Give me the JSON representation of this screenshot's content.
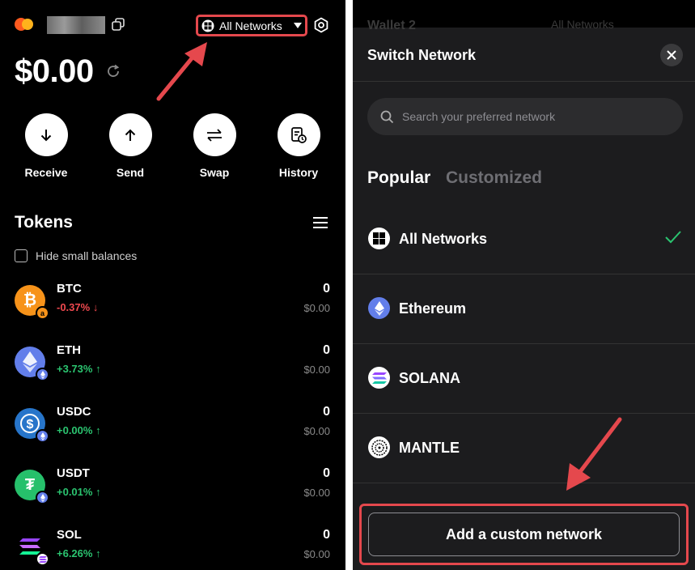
{
  "left": {
    "network_button_label": "All Networks",
    "balance": "$0.00",
    "actions": [
      {
        "label": "Receive",
        "icon": "arrow-down-icon"
      },
      {
        "label": "Send",
        "icon": "arrow-up-icon"
      },
      {
        "label": "Swap",
        "icon": "swap-icon"
      },
      {
        "label": "History",
        "icon": "history-icon"
      }
    ],
    "tokens_title": "Tokens",
    "hide_small_balances": "Hide small balances",
    "tokens": [
      {
        "symbol": "BTC",
        "change": "-0.37%",
        "direction": "down",
        "amount": "0",
        "usd": "$0.00",
        "color": "#f7931a"
      },
      {
        "symbol": "ETH",
        "change": "+3.73%",
        "direction": "up",
        "amount": "0",
        "usd": "$0.00",
        "color": "#627eea"
      },
      {
        "symbol": "USDC",
        "change": "+0.00%",
        "direction": "up",
        "amount": "0",
        "usd": "$0.00",
        "color": "#2775ca"
      },
      {
        "symbol": "USDT",
        "change": "+0.01%",
        "direction": "up",
        "amount": "0",
        "usd": "$0.00",
        "color": "#26c06b"
      },
      {
        "symbol": "SOL",
        "change": "+6.26%",
        "direction": "up",
        "amount": "0",
        "usd": "$0.00",
        "color": "#000000"
      }
    ]
  },
  "right": {
    "ghost_wallet": "Wallet 2",
    "ghost_network": "All Networks",
    "title": "Switch Network",
    "search_placeholder": "Search your preferred network",
    "tabs": [
      "Popular",
      "Customized"
    ],
    "networks": [
      {
        "label": "All Networks",
        "icon": "all-networks-icon",
        "selected": true
      },
      {
        "label": "Ethereum",
        "icon": "ethereum-icon",
        "selected": false
      },
      {
        "label": "SOLANA",
        "icon": "solana-icon",
        "selected": false
      },
      {
        "label": "MANTLE",
        "icon": "mantle-icon",
        "selected": false
      }
    ],
    "add_custom_label": "Add a custom network"
  },
  "colors": {
    "highlight": "#e5484d",
    "positive": "#2bc470",
    "negative": "#f0494f"
  }
}
